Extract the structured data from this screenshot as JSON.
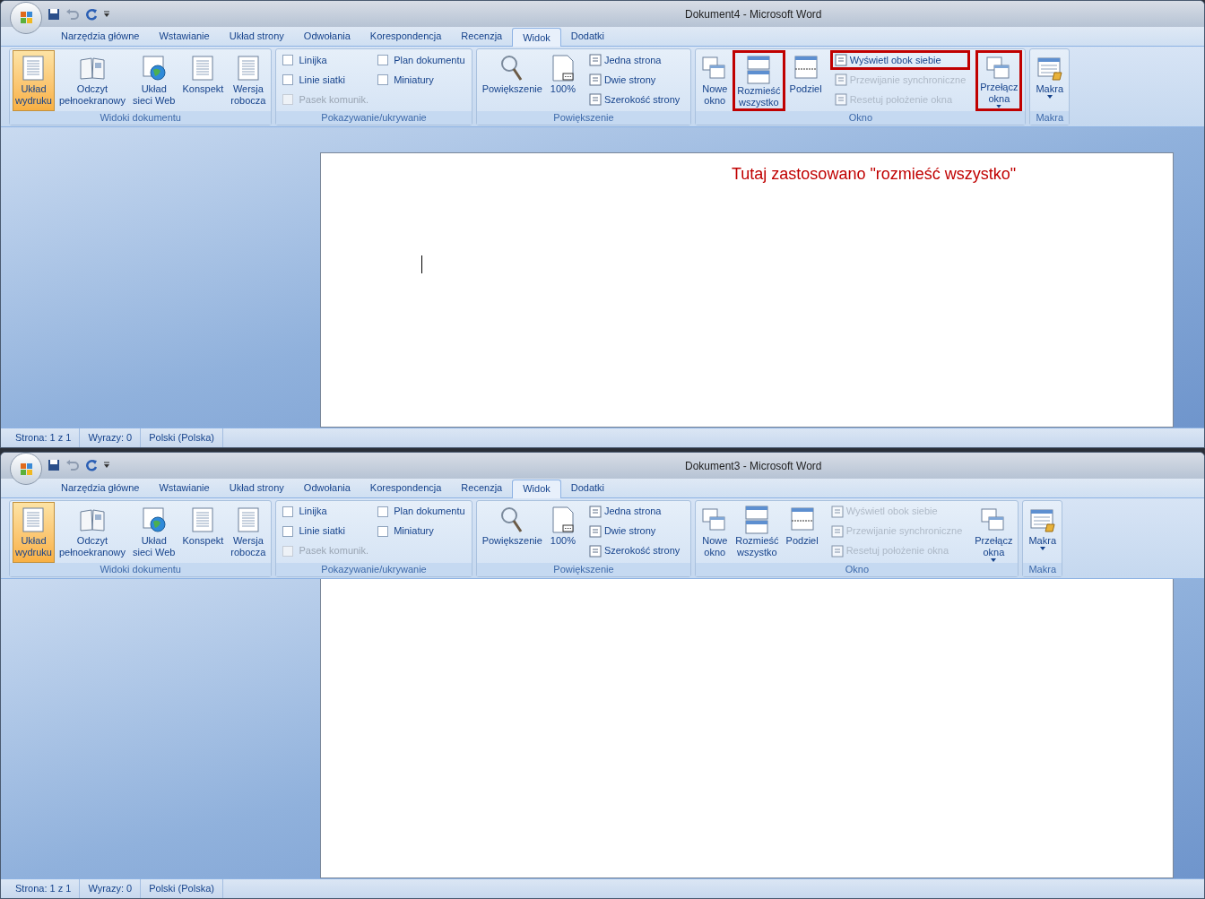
{
  "windows": [
    {
      "title": "Dokument4 - Microsoft Word",
      "tabs": [
        {
          "label": "Narzędzia główne",
          "selected": false
        },
        {
          "label": "Wstawianie",
          "selected": false
        },
        {
          "label": "Układ strony",
          "selected": false
        },
        {
          "label": "Odwołania",
          "selected": false
        },
        {
          "label": "Korespondencja",
          "selected": false
        },
        {
          "label": "Recenzja",
          "selected": false
        },
        {
          "label": "Widok",
          "selected": true
        },
        {
          "label": "Dodatki",
          "selected": false
        }
      ],
      "groups": [
        {
          "label": "Widoki dokumentu",
          "items": [
            {
              "kind": "large",
              "label": "Układ\nwydruku",
              "selected": true
            },
            {
              "kind": "large",
              "label": "Odczyt\npełnoekranowy",
              "selected": false
            },
            {
              "kind": "large",
              "label": "Układ\nsieci Web",
              "selected": false
            },
            {
              "kind": "large",
              "label": "Konspekt",
              "selected": false
            },
            {
              "kind": "large",
              "label": "Wersja\nrobocza",
              "selected": false
            }
          ]
        },
        {
          "label": "Pokazywanie/ukrywanie",
          "items": [
            {
              "kind": "checkbox",
              "label": "Linijka",
              "checked": false,
              "disabled": false
            },
            {
              "kind": "checkbox",
              "label": "Linie siatki",
              "checked": false,
              "disabled": false
            },
            {
              "kind": "checkbox",
              "label": "Pasek komunik.",
              "checked": false,
              "disabled": true
            },
            {
              "kind": "checkbox",
              "label": "Plan dokumentu",
              "checked": false,
              "disabled": false
            },
            {
              "kind": "checkbox",
              "label": "Miniatury",
              "checked": false,
              "disabled": false
            }
          ]
        },
        {
          "label": "Powiększenie",
          "items": [
            {
              "kind": "large",
              "label": "Powiększenie"
            },
            {
              "kind": "large",
              "label": "100%"
            },
            {
              "kind": "small",
              "label": "Jedna strona",
              "disabled": false
            },
            {
              "kind": "small",
              "label": "Dwie strony",
              "disabled": false
            },
            {
              "kind": "small",
              "label": "Szerokość strony",
              "disabled": false
            }
          ]
        },
        {
          "label": "Okno",
          "items": [
            {
              "kind": "large",
              "label": "Nowe\nokno",
              "highlighted": false
            },
            {
              "kind": "large",
              "label": "Rozmieść\nwszystko",
              "highlighted": true
            },
            {
              "kind": "large",
              "label": "Podziel",
              "highlighted": false
            },
            {
              "kind": "small",
              "label": "Wyświetl obok siebie",
              "disabled": false,
              "highlighted": true
            },
            {
              "kind": "small",
              "label": "Przewijanie synchroniczne",
              "disabled": true,
              "highlighted": false
            },
            {
              "kind": "small",
              "label": "Resetuj położenie okna",
              "disabled": true,
              "highlighted": false
            },
            {
              "kind": "large",
              "label": "Przełącz\nokna",
              "dropdown": true,
              "highlighted": true
            }
          ]
        },
        {
          "label": "Makra",
          "items": [
            {
              "kind": "large",
              "label": "Makra",
              "dropdown": true
            }
          ]
        }
      ],
      "document": {
        "annotation": "Tutaj zastosowano \"rozmieść wszystko\"",
        "cursor": true,
        "scrolled": false
      },
      "status_bar": [
        "Strona: 1 z 1",
        "Wyrazy: 0",
        "Polski (Polska)"
      ]
    },
    {
      "title": "Dokument3 - Microsoft Word",
      "tabs": [
        {
          "label": "Narzędzia główne",
          "selected": false
        },
        {
          "label": "Wstawianie",
          "selected": false
        },
        {
          "label": "Układ strony",
          "selected": false
        },
        {
          "label": "Odwołania",
          "selected": false
        },
        {
          "label": "Korespondencja",
          "selected": false
        },
        {
          "label": "Recenzja",
          "selected": false
        },
        {
          "label": "Widok",
          "selected": true
        },
        {
          "label": "Dodatki",
          "selected": false
        }
      ],
      "groups": [
        {
          "label": "Widoki dokumentu",
          "items": [
            {
              "kind": "large",
              "label": "Układ\nwydruku",
              "selected": true
            },
            {
              "kind": "large",
              "label": "Odczyt\npełnoekranowy",
              "selected": false
            },
            {
              "kind": "large",
              "label": "Układ\nsieci Web",
              "selected": false
            },
            {
              "kind": "large",
              "label": "Konspekt",
              "selected": false
            },
            {
              "kind": "large",
              "label": "Wersja\nrobocza",
              "selected": false
            }
          ]
        },
        {
          "label": "Pokazywanie/ukrywanie",
          "items": [
            {
              "kind": "checkbox",
              "label": "Linijka",
              "checked": false,
              "disabled": false
            },
            {
              "kind": "checkbox",
              "label": "Linie siatki",
              "checked": false,
              "disabled": false
            },
            {
              "kind": "checkbox",
              "label": "Pasek komunik.",
              "checked": false,
              "disabled": true
            },
            {
              "kind": "checkbox",
              "label": "Plan dokumentu",
              "checked": false,
              "disabled": false
            },
            {
              "kind": "checkbox",
              "label": "Miniatury",
              "checked": false,
              "disabled": false
            }
          ]
        },
        {
          "label": "Powiększenie",
          "items": [
            {
              "kind": "large",
              "label": "Powiększenie"
            },
            {
              "kind": "large",
              "label": "100%"
            },
            {
              "kind": "small",
              "label": "Jedna strona",
              "disabled": false
            },
            {
              "kind": "small",
              "label": "Dwie strony",
              "disabled": false
            },
            {
              "kind": "small",
              "label": "Szerokość strony",
              "disabled": false
            }
          ]
        },
        {
          "label": "Okno",
          "items": [
            {
              "kind": "large",
              "label": "Nowe\nokno",
              "highlighted": false
            },
            {
              "kind": "large",
              "label": "Rozmieść\nwszystko",
              "highlighted": false
            },
            {
              "kind": "large",
              "label": "Podziel",
              "highlighted": false
            },
            {
              "kind": "small",
              "label": "Wyświetl obok siebie",
              "disabled": true,
              "highlighted": false
            },
            {
              "kind": "small",
              "label": "Przewijanie synchroniczne",
              "disabled": true,
              "highlighted": false
            },
            {
              "kind": "small",
              "label": "Resetuj położenie okna",
              "disabled": true,
              "highlighted": false
            },
            {
              "kind": "large",
              "label": "Przełącz\nokna",
              "dropdown": true,
              "highlighted": false
            }
          ]
        },
        {
          "label": "Makra",
          "items": [
            {
              "kind": "large",
              "label": "Makra",
              "dropdown": true
            }
          ]
        }
      ],
      "document": {
        "cursor": false,
        "scrolled": true
      },
      "status_bar": [
        "Strona: 1 z 1",
        "Wyrazy: 0",
        "Polski (Polska)"
      ]
    }
  ]
}
